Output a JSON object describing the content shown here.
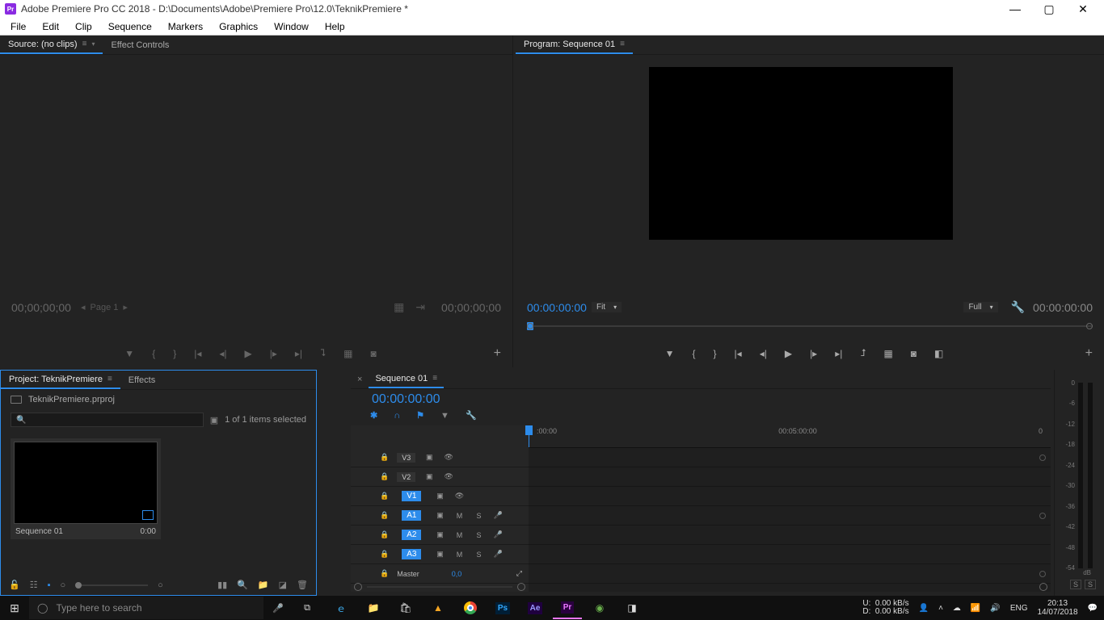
{
  "titlebar": {
    "app_icon": "Pr",
    "title": "Adobe Premiere Pro CC 2018 - D:\\Documents\\Adobe\\Premiere Pro\\12.0\\TeknikPremiere *"
  },
  "menu": [
    "File",
    "Edit",
    "Clip",
    "Sequence",
    "Markers",
    "Graphics",
    "Window",
    "Help"
  ],
  "source": {
    "tab_source": "Source: (no clips)",
    "tab_effects": "Effect Controls",
    "tc_left": "00;00;00;00",
    "tc_right": "00;00;00;00",
    "pager": "Page 1"
  },
  "program": {
    "tab": "Program: Sequence 01",
    "tc_left": "00:00:00:00",
    "fit": "Fit",
    "full": "Full",
    "tc_right": "00:00:00:00"
  },
  "project": {
    "tab_project": "Project: TeknikPremiere",
    "tab_effects": "Effects",
    "filename": "TeknikPremiere.prproj",
    "items": "1 of 1 items selected",
    "thumb_name": "Sequence 01",
    "thumb_dur": "0:00"
  },
  "timeline": {
    "tab": "Sequence 01",
    "tc": "00:00:00:00",
    "ruler": [
      ":00:00",
      "00:05:00:00",
      "0"
    ],
    "tracks": {
      "v3": "V3",
      "v2": "V2",
      "v1": "V1",
      "a1": "A1",
      "a2": "A2",
      "a3": "A3",
      "master": "Master",
      "master_val": "0,0"
    }
  },
  "meters": {
    "db": [
      "0",
      "-6",
      "-12",
      "-18",
      "-24",
      "-30",
      "-36",
      "-42",
      "-48",
      "-54",
      ""
    ],
    "label": "dB"
  },
  "taskbar": {
    "search_placeholder": "Type here to search",
    "net": {
      "u": "U:",
      "d": "D:",
      "uv": "0.00 kB/s",
      "dv": "0.00 kB/s"
    },
    "lang": "ENG",
    "time": "20:13",
    "date": "14/07/2018"
  }
}
